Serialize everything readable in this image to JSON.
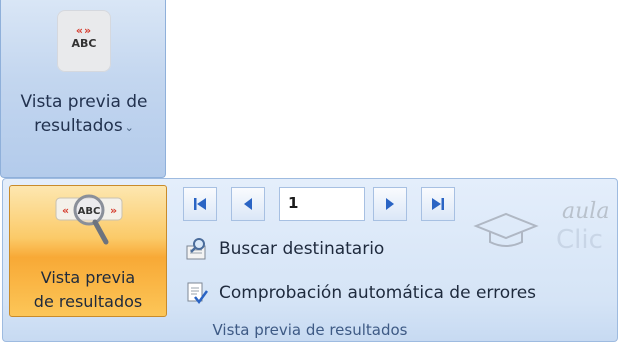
{
  "top_button": {
    "icon": "preview-results-icon",
    "icon_glyph_arrows": "«»",
    "icon_text": "ABC",
    "label_line1": "Vista previa de",
    "label_line2": "resultados",
    "dropdown_glyph": "⌄"
  },
  "group": {
    "title": "Vista previa de resultados",
    "big_button": {
      "icon": "magnifier-abc-icon",
      "icon_text": "ABC",
      "label_line1": "Vista previa",
      "label_line2": "de resultados"
    },
    "navigation": {
      "record_value": "1",
      "buttons": [
        "first-record",
        "previous-record",
        "next-record",
        "last-record"
      ]
    },
    "commands": [
      {
        "name": "find-recipient",
        "icon": "find-recipient-icon",
        "label": "Buscar destinatario"
      },
      {
        "name": "auto-check-errors",
        "icon": "check-errors-icon",
        "label": "Comprobación automática de errores"
      }
    ]
  },
  "watermark": {
    "line1": "aula",
    "line2": "Clic"
  },
  "colors": {
    "accent_orange": "#f8a936",
    "ribbon_blue": "#d5e4f6",
    "arrow_blue": "#2a64c4",
    "label_blue": "#3e5a85"
  }
}
